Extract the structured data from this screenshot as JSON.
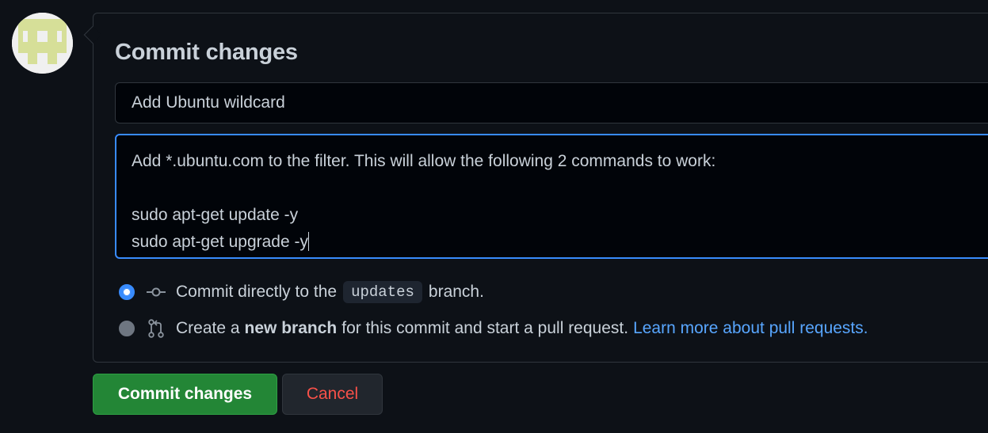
{
  "panel": {
    "title": "Commit changes"
  },
  "summary": {
    "value": "Add Ubuntu wildcard"
  },
  "description": {
    "value": "Add *.ubuntu.com to the filter. This will allow the following 2 commands to work:\n\nsudo apt-get update -y\nsudo apt-get upgrade -y"
  },
  "options": {
    "direct": {
      "prefix": "Commit directly to the",
      "branch": "updates",
      "suffix": "branch.",
      "selected": true
    },
    "new_branch": {
      "prefix": "Create a",
      "bold": "new branch",
      "suffix": "for this commit and start a pull request.",
      "link": "Learn more about pull requests.",
      "selected": false
    }
  },
  "buttons": {
    "commit": "Commit changes",
    "cancel": "Cancel"
  },
  "colors": {
    "accent": "#388bfd",
    "commit_bg": "#238636",
    "danger": "#f85149",
    "link": "#58a6ff",
    "avatar": "#d6df98"
  },
  "icons": {
    "avatar": "identicon",
    "commit": "git-commit-icon",
    "pull_request": "git-pull-request-icon"
  }
}
